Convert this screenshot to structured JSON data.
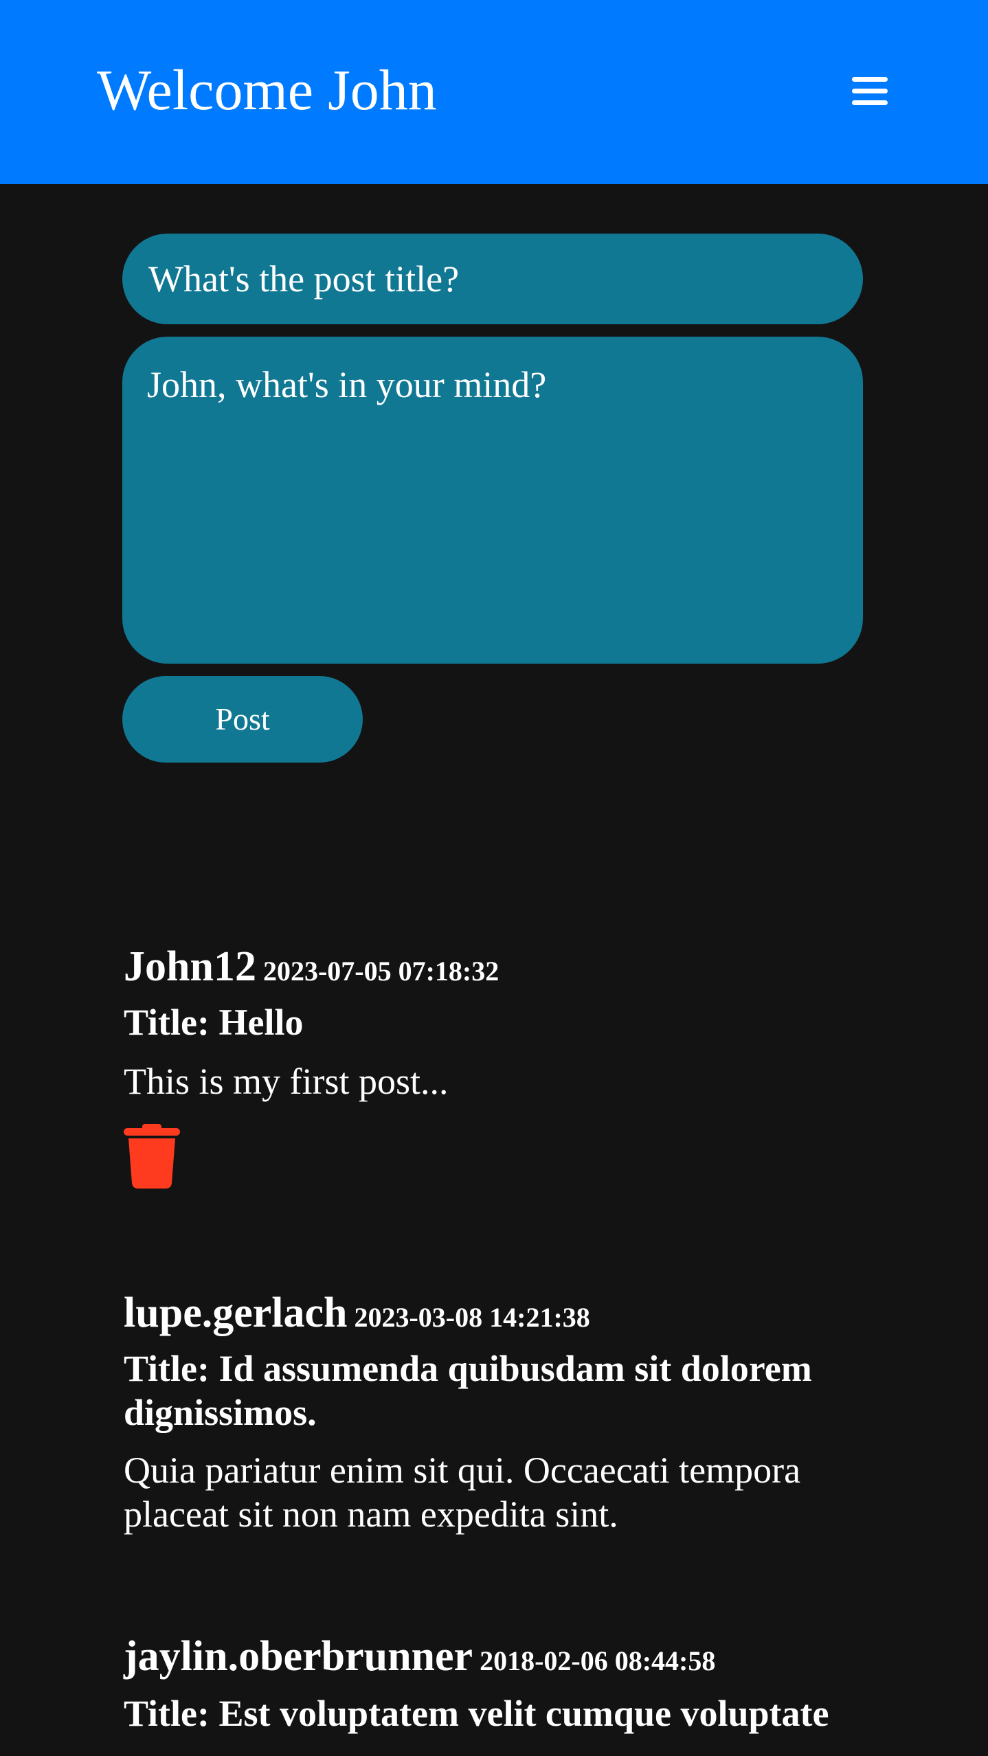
{
  "header": {
    "title": "Welcome John",
    "menu_icon": "hamburger-menu-icon",
    "background": "#007bff"
  },
  "composer": {
    "title_placeholder": "What's the post title?",
    "body_placeholder": "John, what's in your mind?",
    "post_label": "Post",
    "accent": "#117894"
  },
  "posts": [
    {
      "author": "John12",
      "date": "2023-07-05 07:18:32",
      "title": "Title: Hello",
      "body": "This is my first post...",
      "delete_icon": "trash-icon",
      "delete_color": "#ff3b1f"
    },
    {
      "author": "lupe.gerlach",
      "date": "2023-03-08 14:21:38",
      "title": "Title: Id assumenda quibusdam sit dolorem dignissimos.",
      "body": "Quia pariatur enim sit qui. Occaecati tempora placeat sit non nam expedita sint."
    },
    {
      "author": "jaylin.oberbrunner",
      "date": "2018-02-06 08:44:58",
      "title": "Title: Est voluptatem velit cumque voluptate"
    }
  ],
  "colors": {
    "page_background": "#131313",
    "text": "#ffffff"
  }
}
